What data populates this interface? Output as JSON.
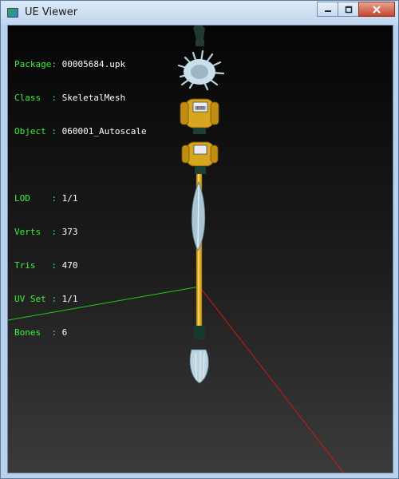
{
  "window": {
    "title": "UE Viewer"
  },
  "info": {
    "package": {
      "label": "Package: ",
      "value": "00005684.upk"
    },
    "class": {
      "label": "Class  : ",
      "value": "SkeletalMesh"
    },
    "object": {
      "label": "Object : ",
      "value": "060001_Autoscale"
    },
    "lod": {
      "label": "LOD    : ",
      "value": "1/1"
    },
    "verts": {
      "label": "Verts  : ",
      "value": "373"
    },
    "tris": {
      "label": "Tris   : ",
      "value": "470"
    },
    "uvset": {
      "label": "UV Set : ",
      "value": "1/1"
    },
    "bones": {
      "label": "Bones  : ",
      "value": "6"
    }
  },
  "colors": {
    "info_label": "#3cf03c",
    "info_value": "#ffffff",
    "axis_x": "#d01818",
    "axis_z": "#22c822",
    "mesh_gold": "#d8a51e",
    "feather": "#b6d0e0"
  },
  "icons": {
    "app": "app-icon",
    "minimize": "minimize-icon",
    "maximize": "maximize-icon",
    "close": "close-icon"
  }
}
